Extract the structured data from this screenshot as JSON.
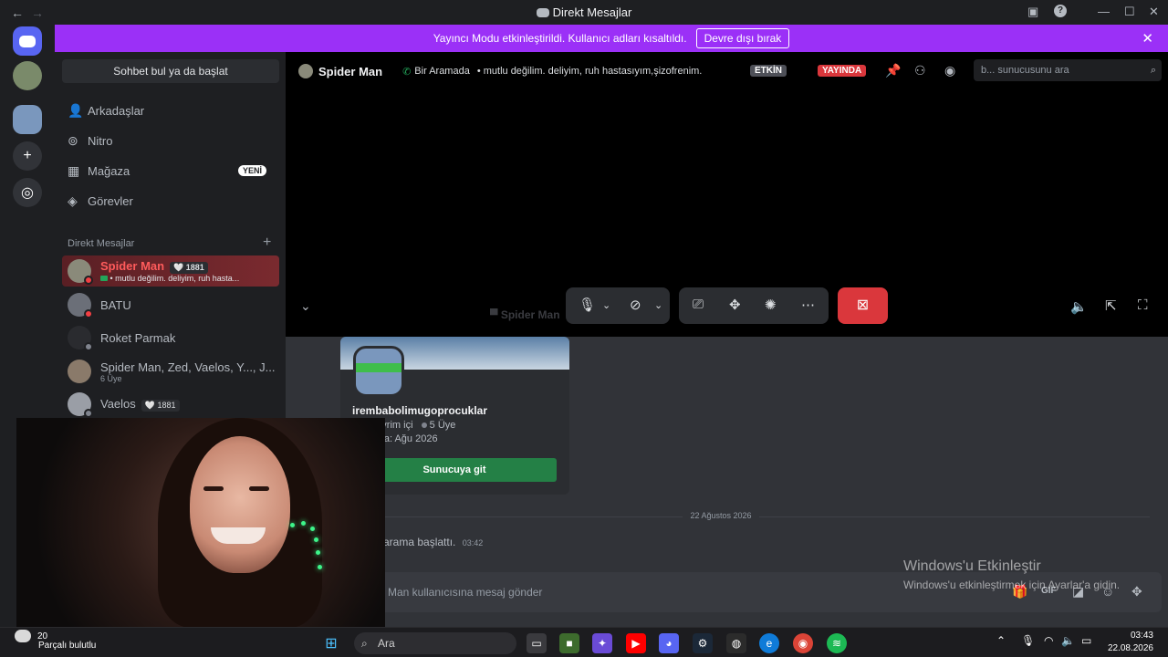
{
  "window": {
    "title": "Direkt Mesajlar",
    "back": "←",
    "forward": "→"
  },
  "banner": {
    "text": "Yayıncı Modu etkinleştirildi. Kullanıcı adları kısaltıldı.",
    "button": "Devre dışı bırak"
  },
  "dm_panel": {
    "search": "Sohbet bul ya da başlat",
    "nav": [
      {
        "label": "Arkadaşlar",
        "icon": "friends-icon"
      },
      {
        "label": "Nitro",
        "icon": "nitro-icon"
      },
      {
        "label": "Mağaza",
        "icon": "shop-icon",
        "badge": "YENİ"
      },
      {
        "label": "Görevler",
        "icon": "quests-icon"
      }
    ],
    "header": "Direkt Mesajlar",
    "dms": [
      {
        "name": "Spider Man",
        "tag": "🤍 1881",
        "sub": "• mutlu değilim. deliyim, ruh hasta..."
      },
      {
        "name": "BATU",
        "tag": "",
        "sub": ""
      },
      {
        "name": "Roket Parmak",
        "tag": "",
        "sub": ""
      },
      {
        "name": "Spider Man, Zed, Vaelos, Y..., J...",
        "tag": "",
        "sub": "6 Üye"
      },
      {
        "name": "Vaelos",
        "tag": "🤍 1881",
        "sub": ""
      }
    ]
  },
  "call_header": {
    "name": "Spider Man",
    "in_call": "Bir Aramada",
    "status": "• mutlu değilim. deliyim, ruh hastasıyım,şizofrenim.",
    "etkin": "ETKİN",
    "yayinda": "YAYINDA",
    "search_placeholder": "b... sunucusunu ara"
  },
  "call": {
    "watermark_name": "Spider Man"
  },
  "invite": {
    "server_name": "irembabolimugoprocuklar",
    "online": "2 Çevrim içi",
    "members": "5 Üye",
    "founded": "Kurulma: Ağu 2026",
    "button": "Sunucuya git"
  },
  "chat": {
    "date": "22 Ağustos 2026",
    "message": "arama başlattı.",
    "message_time": "03:42",
    "composer_placeholder": "Man kullanıcısına mesaj gönder"
  },
  "watermark": {
    "line1": "Windows'u Etkinleştir",
    "line2": "Windows'u etkinleştirmek için Ayarlar'a gidin."
  },
  "taskbar": {
    "weather_temp": "20",
    "weather_text": "Parçalı bulutlu",
    "search": "Ara",
    "time": "03:43",
    "date": "22.08.2026"
  },
  "colors": {
    "brand": "#5865f2",
    "banner": "#9b30f7",
    "end_call": "#da373c",
    "join": "#248046",
    "live": "#da373c"
  }
}
